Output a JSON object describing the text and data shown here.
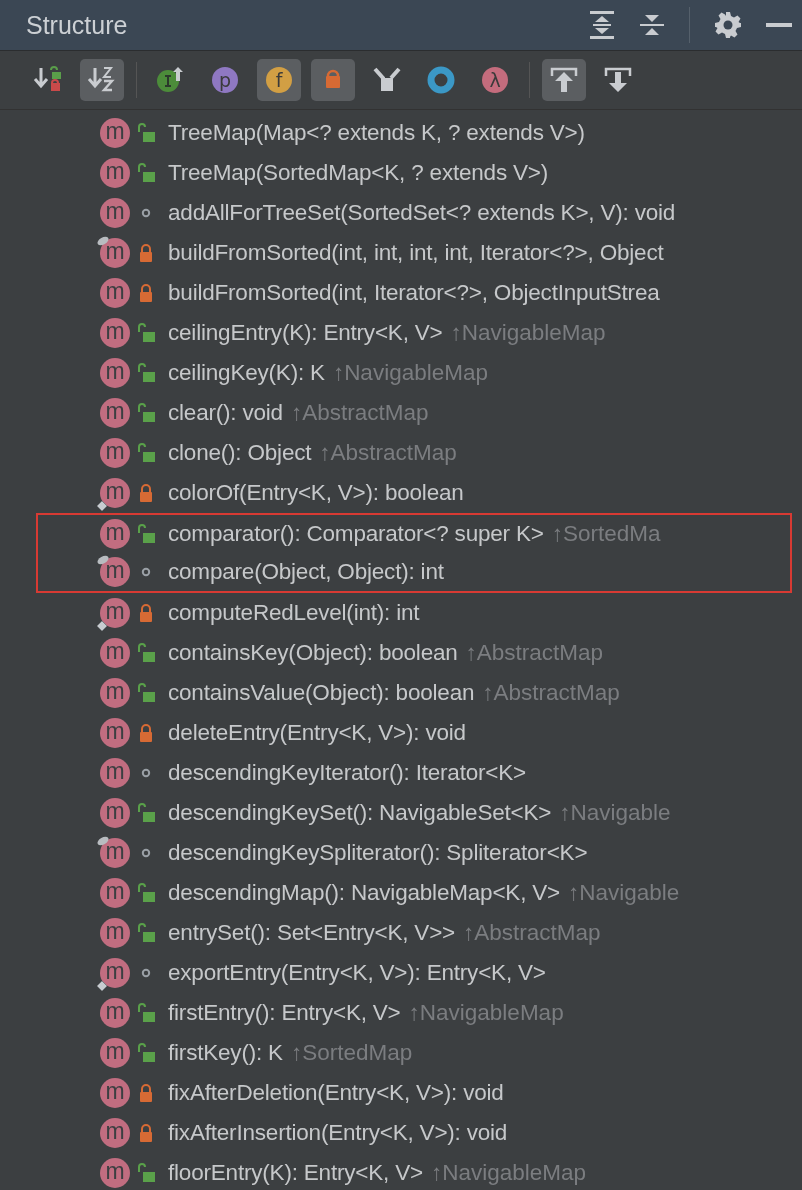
{
  "panel": {
    "title": "Structure"
  },
  "header_actions": [
    {
      "kind": "expand"
    },
    {
      "kind": "collapse"
    },
    {
      "kind": "settings"
    },
    {
      "kind": "minimize"
    }
  ],
  "toolbar": [
    {
      "kind": "sort-visibility",
      "selected": false
    },
    {
      "kind": "sort-alpha",
      "selected": true
    },
    {
      "kind": "inherited",
      "selected": false
    },
    {
      "kind": "properties",
      "selected": false,
      "text": "p"
    },
    {
      "kind": "fields",
      "selected": true,
      "text": "f"
    },
    {
      "kind": "non-public",
      "selected": true
    },
    {
      "kind": "fork",
      "selected": false
    },
    {
      "kind": "anonymous",
      "selected": false
    },
    {
      "kind": "lambda",
      "selected": false,
      "text": "λ"
    },
    {
      "kind": "autoscroll-to",
      "selected": true
    },
    {
      "kind": "autoscroll-from",
      "selected": false
    }
  ],
  "members": [
    {
      "kind": "public",
      "icon_letter": "m",
      "signature": "TreeMap(Map<? extends K, ? extends V>)"
    },
    {
      "kind": "public",
      "icon_letter": "m",
      "signature": "TreeMap(SortedMap<K, ? extends V>)"
    },
    {
      "kind": "package",
      "icon_letter": "m",
      "signature": "addAllForTreeSet(SortedSet<? extends K>, V): void"
    },
    {
      "kind": "private",
      "icon_letter": "m",
      "pinned": true,
      "signature": "buildFromSorted(int, int, int, int, Iterator<?>, Object"
    },
    {
      "kind": "private",
      "icon_letter": "m",
      "signature": "buildFromSorted(int, Iterator<?>, ObjectInputStrea"
    },
    {
      "kind": "public",
      "icon_letter": "m",
      "signature": "ceilingEntry(K): Entry<K, V>",
      "inherited": "↑NavigableMap"
    },
    {
      "kind": "public",
      "icon_letter": "m",
      "signature": "ceilingKey(K): K",
      "inherited": "↑NavigableMap"
    },
    {
      "kind": "public",
      "icon_letter": "m",
      "signature": "clear(): void",
      "inherited": "↑AbstractMap"
    },
    {
      "kind": "public",
      "icon_letter": "m",
      "signature": "clone(): Object",
      "inherited": "↑AbstractMap"
    },
    {
      "kind": "private",
      "icon_letter": "m",
      "diamond": true,
      "signature": "colorOf(Entry<K, V>): boolean"
    },
    {
      "kind": "public",
      "icon_letter": "m",
      "boxed": true,
      "signature": "comparator(): Comparator<? super K>",
      "inherited": "↑SortedMa"
    },
    {
      "kind": "package",
      "icon_letter": "m",
      "boxed": true,
      "pinned": true,
      "signature": "compare(Object, Object): int"
    },
    {
      "kind": "private",
      "icon_letter": "m",
      "diamond": true,
      "signature": "computeRedLevel(int): int"
    },
    {
      "kind": "public",
      "icon_letter": "m",
      "signature": "containsKey(Object): boolean",
      "inherited": "↑AbstractMap"
    },
    {
      "kind": "public",
      "icon_letter": "m",
      "signature": "containsValue(Object): boolean",
      "inherited": "↑AbstractMap"
    },
    {
      "kind": "private",
      "icon_letter": "m",
      "signature": "deleteEntry(Entry<K, V>): void"
    },
    {
      "kind": "package",
      "icon_letter": "m",
      "signature": "descendingKeyIterator(): Iterator<K>"
    },
    {
      "kind": "public",
      "icon_letter": "m",
      "signature": "descendingKeySet(): NavigableSet<K>",
      "inherited": "↑Navigable"
    },
    {
      "kind": "package",
      "icon_letter": "m",
      "pinned": true,
      "signature": "descendingKeySpliterator(): Spliterator<K>"
    },
    {
      "kind": "public",
      "icon_letter": "m",
      "signature": "descendingMap(): NavigableMap<K, V>",
      "inherited": "↑Navigable"
    },
    {
      "kind": "public",
      "icon_letter": "m",
      "signature": "entrySet(): Set<Entry<K, V>>",
      "inherited": "↑AbstractMap"
    },
    {
      "kind": "package",
      "icon_letter": "m",
      "diamond": true,
      "signature": "exportEntry(Entry<K, V>): Entry<K, V>"
    },
    {
      "kind": "public",
      "icon_letter": "m",
      "signature": "firstEntry(): Entry<K, V>",
      "inherited": "↑NavigableMap"
    },
    {
      "kind": "public",
      "icon_letter": "m",
      "signature": "firstKey(): K",
      "inherited": "↑SortedMap"
    },
    {
      "kind": "private",
      "icon_letter": "m",
      "signature": "fixAfterDeletion(Entry<K, V>): void"
    },
    {
      "kind": "private",
      "icon_letter": "m",
      "signature": "fixAfterInsertion(Entry<K, V>): void"
    },
    {
      "kind": "public",
      "icon_letter": "m",
      "signature": "floorEntry(K): Entry<K, V>",
      "inherited": "↑NavigableMap"
    }
  ]
}
